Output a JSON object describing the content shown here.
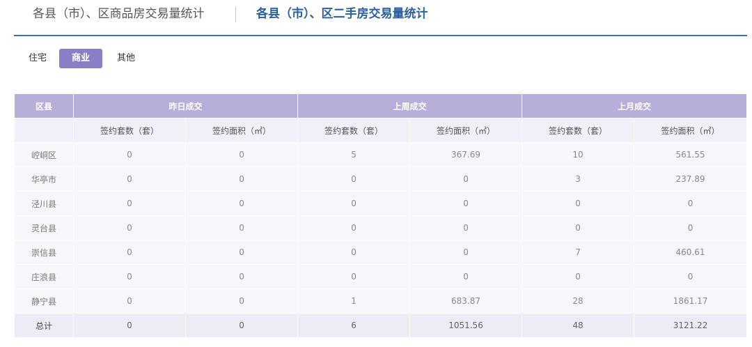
{
  "header": {
    "tab_inactive": "各县（市）、区商品房交易量统计",
    "tab_active": "各县（市）、区二手房交易量统计"
  },
  "subtabs": [
    "住宅",
    "商业",
    "其他"
  ],
  "table": {
    "group_headers": [
      "区县",
      "昨日成交",
      "上周成交",
      "上月成交"
    ],
    "sub_headers": [
      "签约套数（套）",
      "签约面积（㎡）",
      "签约套数（套）",
      "签约面积（㎡）",
      "签约套数（套）",
      "签约面积（㎡）"
    ],
    "rows": [
      [
        "崆峒区",
        "0",
        "0",
        "5",
        "367.69",
        "10",
        "561.55"
      ],
      [
        "华亭市",
        "0",
        "0",
        "0",
        "0",
        "3",
        "237.89"
      ],
      [
        "泾川县",
        "0",
        "0",
        "0",
        "0",
        "0",
        "0"
      ],
      [
        "灵台县",
        "0",
        "0",
        "0",
        "0",
        "0",
        "0"
      ],
      [
        "崇信县",
        "0",
        "0",
        "0",
        "0",
        "7",
        "460.61"
      ],
      [
        "庄浪县",
        "0",
        "0",
        "0",
        "0",
        "0",
        "0"
      ],
      [
        "静宁县",
        "0",
        "0",
        "1",
        "683.87",
        "28",
        "1861.17"
      ]
    ],
    "total": [
      "总计",
      "0",
      "0",
      "6",
      "1051.56",
      "48",
      "3121.22"
    ]
  }
}
